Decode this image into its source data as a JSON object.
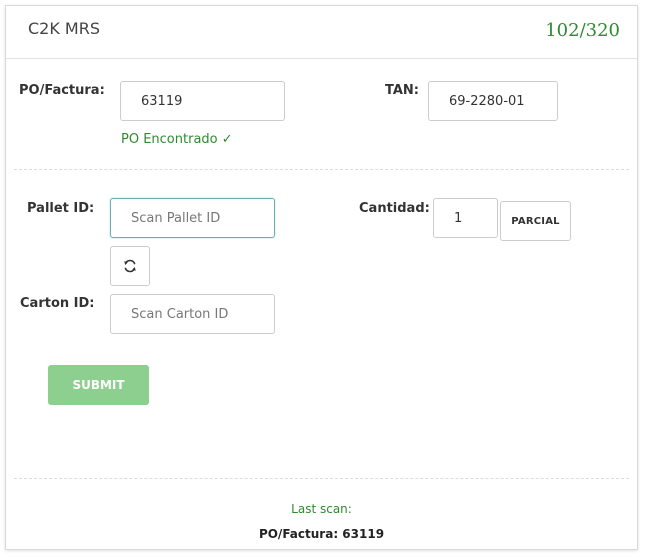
{
  "header": {
    "title": "C2K MRS",
    "counter": "102/320"
  },
  "po": {
    "label": "PO/Factura:",
    "value": "63119",
    "status": "PO Encontrado ✓"
  },
  "tan": {
    "label": "TAN:",
    "value": "69-2280-01"
  },
  "pallet": {
    "label": "Pallet ID:",
    "placeholder": "Scan Pallet ID",
    "refresh_icon": "refresh-icon"
  },
  "cantidad": {
    "label": "Cantidad:",
    "value": "1",
    "parcial_label": "PARCIAL"
  },
  "carton": {
    "label": "Carton ID:",
    "placeholder": "Scan Carton ID"
  },
  "submit": {
    "label": "SUBMIT"
  },
  "footer": {
    "last_scan_label": "Last scan:",
    "last_scan_value": "PO/Factura: 63119"
  },
  "colors": {
    "accent_green": "#2e8b2e",
    "submit_bg": "#8ccf8f",
    "focus_border": "#66b2b2"
  }
}
